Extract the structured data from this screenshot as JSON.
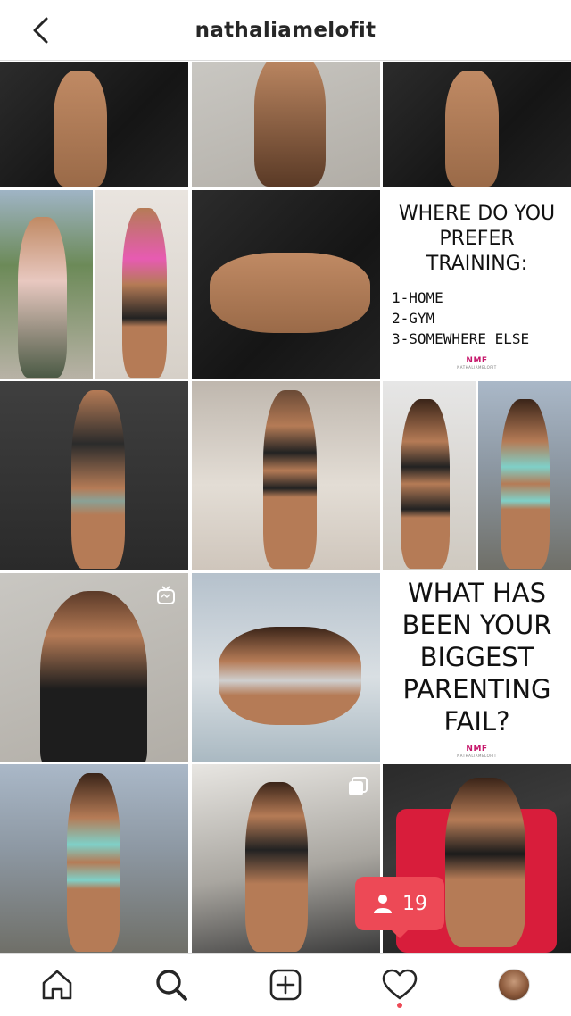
{
  "header": {
    "title": "nathaliamelofit",
    "back_icon": "chevron-left-icon"
  },
  "posts": {
    "text_post_1": {
      "heading_lines": [
        "WHERE DO YOU",
        "PREFER",
        "TRAINING:"
      ],
      "options": [
        "1-HOME",
        "2-GYM",
        "3-SOMEWHERE ELSE"
      ],
      "brand": "NMF",
      "brand_sub": "NATHALIAMELOFIT"
    },
    "text_post_2": {
      "heading_lines": [
        "WHAT HAS",
        "BEEN YOUR",
        "BIGGEST",
        "PARENTING",
        "FAIL?"
      ],
      "brand": "NMF",
      "brand_sub": "NATHALIAMELOFIT"
    }
  },
  "notification_badge": {
    "icon": "person-icon",
    "count": "19",
    "color": "#ed4956"
  },
  "tabbar": {
    "items": [
      "home-icon",
      "search-icon",
      "add-post-icon",
      "activity-heart-icon",
      "profile-avatar"
    ]
  }
}
